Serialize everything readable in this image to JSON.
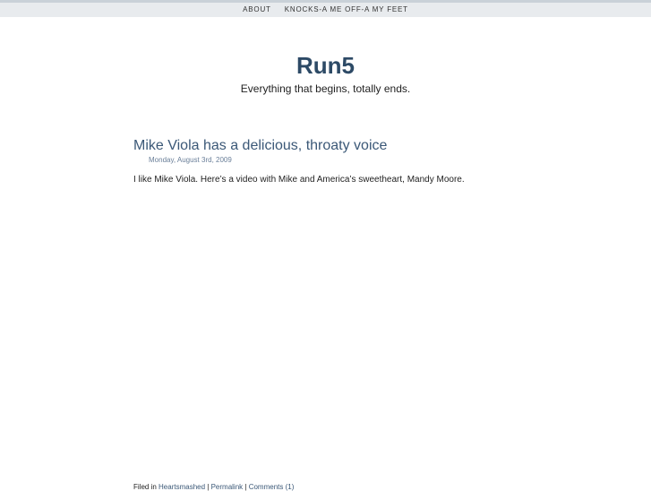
{
  "nav": {
    "items": [
      {
        "label": "ABOUT"
      },
      {
        "label": "KNOCKS-A ME OFF-A MY FEET"
      }
    ]
  },
  "site": {
    "title": "Run5",
    "tagline": "Everything that begins, totally ends."
  },
  "post": {
    "title": "Mike Viola has a delicious, throaty voice",
    "date": "Monday, August 3rd, 2009",
    "body": "I like Mike Viola. Here’s a video with Mike and America’s sweetheart, Mandy Moore.",
    "footer": {
      "filed_label": "Filed in ",
      "category": "Heartsmashed",
      "sep1": " | ",
      "permalink": "Permalink",
      "sep2": " | ",
      "comments": "Comments (1)"
    }
  }
}
